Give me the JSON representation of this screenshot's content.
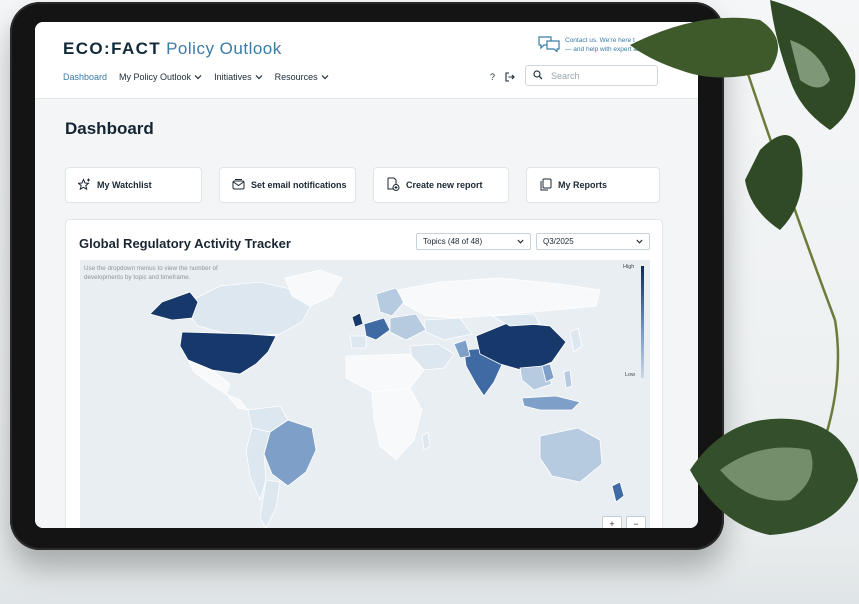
{
  "header": {
    "logo_brand": "ECO:FACT",
    "logo_product": "Policy Outlook",
    "contact_line1": "Contact us. We're here t",
    "contact_line2": "— and help with expert ad",
    "search_placeholder": "Search"
  },
  "nav": {
    "items": [
      {
        "label": "Dashboard"
      },
      {
        "label": "My Policy Outlook"
      },
      {
        "label": "Initiatives"
      },
      {
        "label": "Resources"
      }
    ],
    "help_label": "?",
    "logout_label": "↦"
  },
  "page": {
    "title": "Dashboard",
    "quick_actions": [
      {
        "label": "My Watchlist"
      },
      {
        "label": "Set email notifications"
      },
      {
        "label": "Create new report"
      },
      {
        "label": "My Reports"
      }
    ]
  },
  "tracker": {
    "title": "Global Regulatory Activity Tracker",
    "topics_select": "Topics (48 of 48)",
    "period_select": "Q3/2025",
    "hint": "Use the dropdown menus to view the number of developments by topic and timeframe.",
    "legend_high": "High",
    "legend_low": "Low",
    "colors": {
      "highest": "#16386a",
      "high": "#3f6aa3",
      "mid": "#7d9fc8",
      "low": "#b7cbe0",
      "minimal": "#dde7f0",
      "none": "#f7f9fb"
    }
  }
}
